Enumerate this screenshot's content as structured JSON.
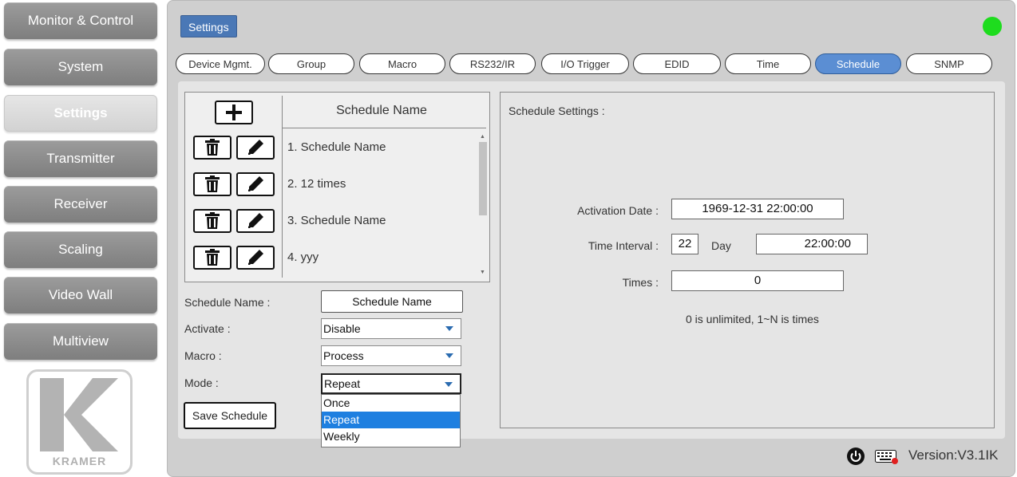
{
  "nav": {
    "items": [
      {
        "label": "Monitor & Control"
      },
      {
        "label": "System"
      },
      {
        "label": "Settings"
      },
      {
        "label": "Transmitter"
      },
      {
        "label": "Receiver"
      },
      {
        "label": "Scaling"
      },
      {
        "label": "Video Wall"
      },
      {
        "label": "Multiview"
      }
    ],
    "active": "Settings",
    "logo_text": "KRAMER"
  },
  "header": {
    "title": "Settings",
    "status_color": "#1edc1e"
  },
  "tabs": [
    {
      "label": "Device Mgmt."
    },
    {
      "label": "Group"
    },
    {
      "label": "Macro"
    },
    {
      "label": "RS232/IR"
    },
    {
      "label": "I/O Trigger"
    },
    {
      "label": "EDID"
    },
    {
      "label": "Time"
    },
    {
      "label": "Schedule"
    },
    {
      "label": "SNMP"
    }
  ],
  "active_tab": "Schedule",
  "schedule_list": {
    "header": "Schedule Name",
    "items": [
      {
        "label": "1. Schedule Name"
      },
      {
        "label": "2. 12 times"
      },
      {
        "label": "3. Schedule Name"
      },
      {
        "label": "4. yyy"
      }
    ]
  },
  "form": {
    "name_label": "Schedule Name :",
    "name_value": "Schedule Name",
    "activate_label": "Activate :",
    "activate_value": "Disable",
    "macro_label": "Macro :",
    "macro_value": "Process",
    "mode_label": "Mode :",
    "mode_value": "Repeat",
    "mode_options": [
      "Once",
      "Repeat",
      "Weekly"
    ],
    "mode_selected": "Repeat",
    "save_label": "Save Schedule"
  },
  "settings_panel": {
    "title": "Schedule Settings :",
    "activation_date_label": "Activation Date :",
    "activation_date_value": "1969-12-31 22:00:00",
    "time_interval_label": "Time Interval :",
    "time_interval_value": "22",
    "time_interval_unit": "Day",
    "time_interval_time": "22:00:00",
    "times_label": "Times :",
    "times_value": "0",
    "hint": "0 is unlimited, 1~N is times"
  },
  "footer": {
    "version": "Version:V3.1IK"
  }
}
